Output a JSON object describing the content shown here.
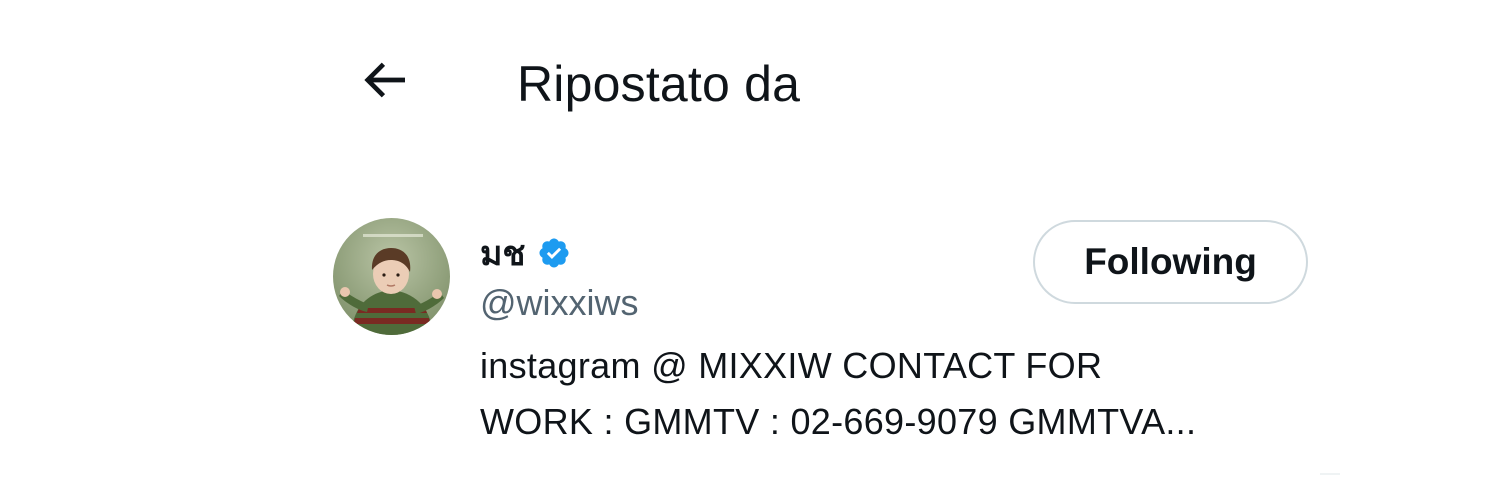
{
  "header": {
    "back_icon": "arrow-left-icon",
    "title": "Ripostato da"
  },
  "user": {
    "avatar_icon": "profile-photo",
    "display_name": "มช",
    "verified_icon": "verified-badge-icon",
    "handle": "@wixxiws",
    "bio_lines": [
      "instagram @ MIXXIW CONTACT FOR",
      "WORK : GMMTV : 02-669-9079 GMMTVA..."
    ],
    "follow_label": "Following"
  },
  "colors": {
    "text_primary": "#0f1419",
    "text_secondary": "#536471",
    "verified_blue": "#1d9bf0",
    "button_border": "#cfd9de"
  }
}
